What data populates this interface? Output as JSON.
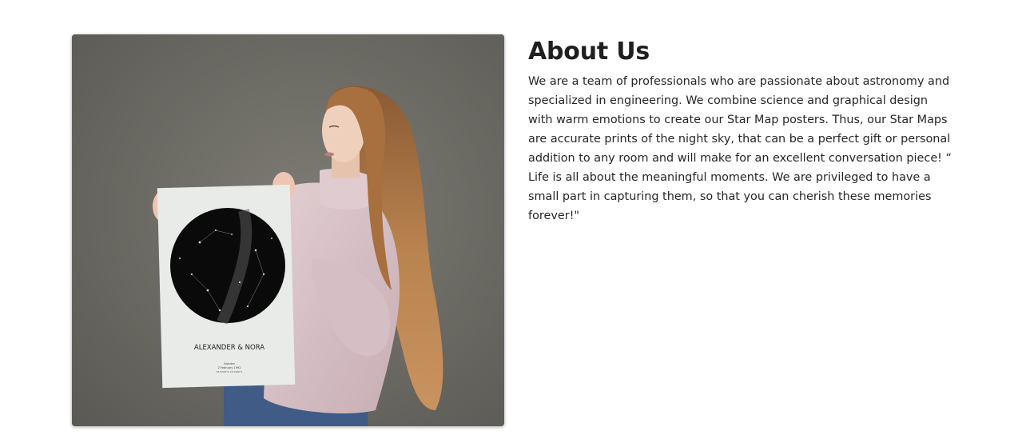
{
  "about": {
    "heading": "About Us",
    "body": "We are a team of professionals who are passionate about astronomy and specialized in engineering. We combine science and graphical design with warm emotions to create our Star Map posters. Thus, our Star Maps are accurate prints of the night sky, that can be a perfect gift or personal addition to any room and will make for an excellent conversation piece! “ Life is all about the meaningful moments. We are privileged to have a small part in capturing them, so that you can cherish these memories forever!\""
  },
  "photo": {
    "poster_title": "ALEXANDER & NORA",
    "poster_place": "Sweden",
    "poster_date": "2 February 1992",
    "poster_coords": "58.8586°N 18.0686°E"
  },
  "colors": {
    "background": "#6e6c66",
    "sweater": "#d8c3c8",
    "hair": "#b07a48",
    "text": "#262626"
  }
}
